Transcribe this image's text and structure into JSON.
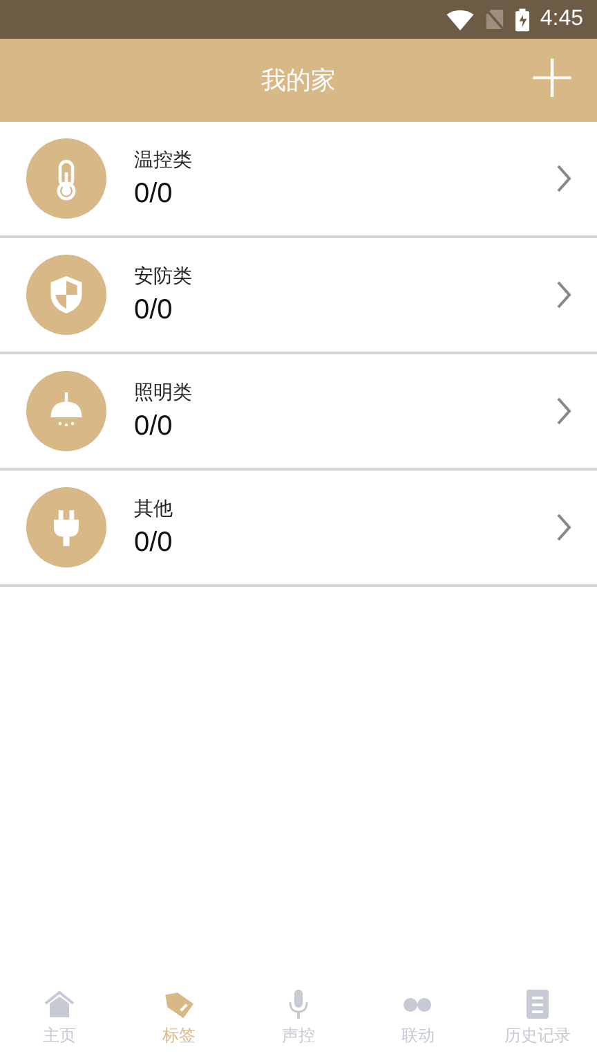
{
  "status_bar": {
    "time": "4:45"
  },
  "app_bar": {
    "title": "我的家",
    "action": "+"
  },
  "categories": [
    {
      "kind": "thermometer",
      "name": "温控类",
      "count": "0/0"
    },
    {
      "kind": "shield",
      "name": "安防类",
      "count": "0/0"
    },
    {
      "kind": "lamp",
      "name": "照明类",
      "count": "0/0"
    },
    {
      "kind": "plug",
      "name": "其他",
      "count": "0/0"
    }
  ],
  "tabs": [
    {
      "kind": "home",
      "label": "主页",
      "selected": false
    },
    {
      "kind": "tag",
      "label": "标签",
      "selected": true
    },
    {
      "kind": "mic",
      "label": "声控",
      "selected": false
    },
    {
      "kind": "link",
      "label": "联动",
      "selected": false
    },
    {
      "kind": "history",
      "label": "历史记录",
      "selected": false
    }
  ]
}
